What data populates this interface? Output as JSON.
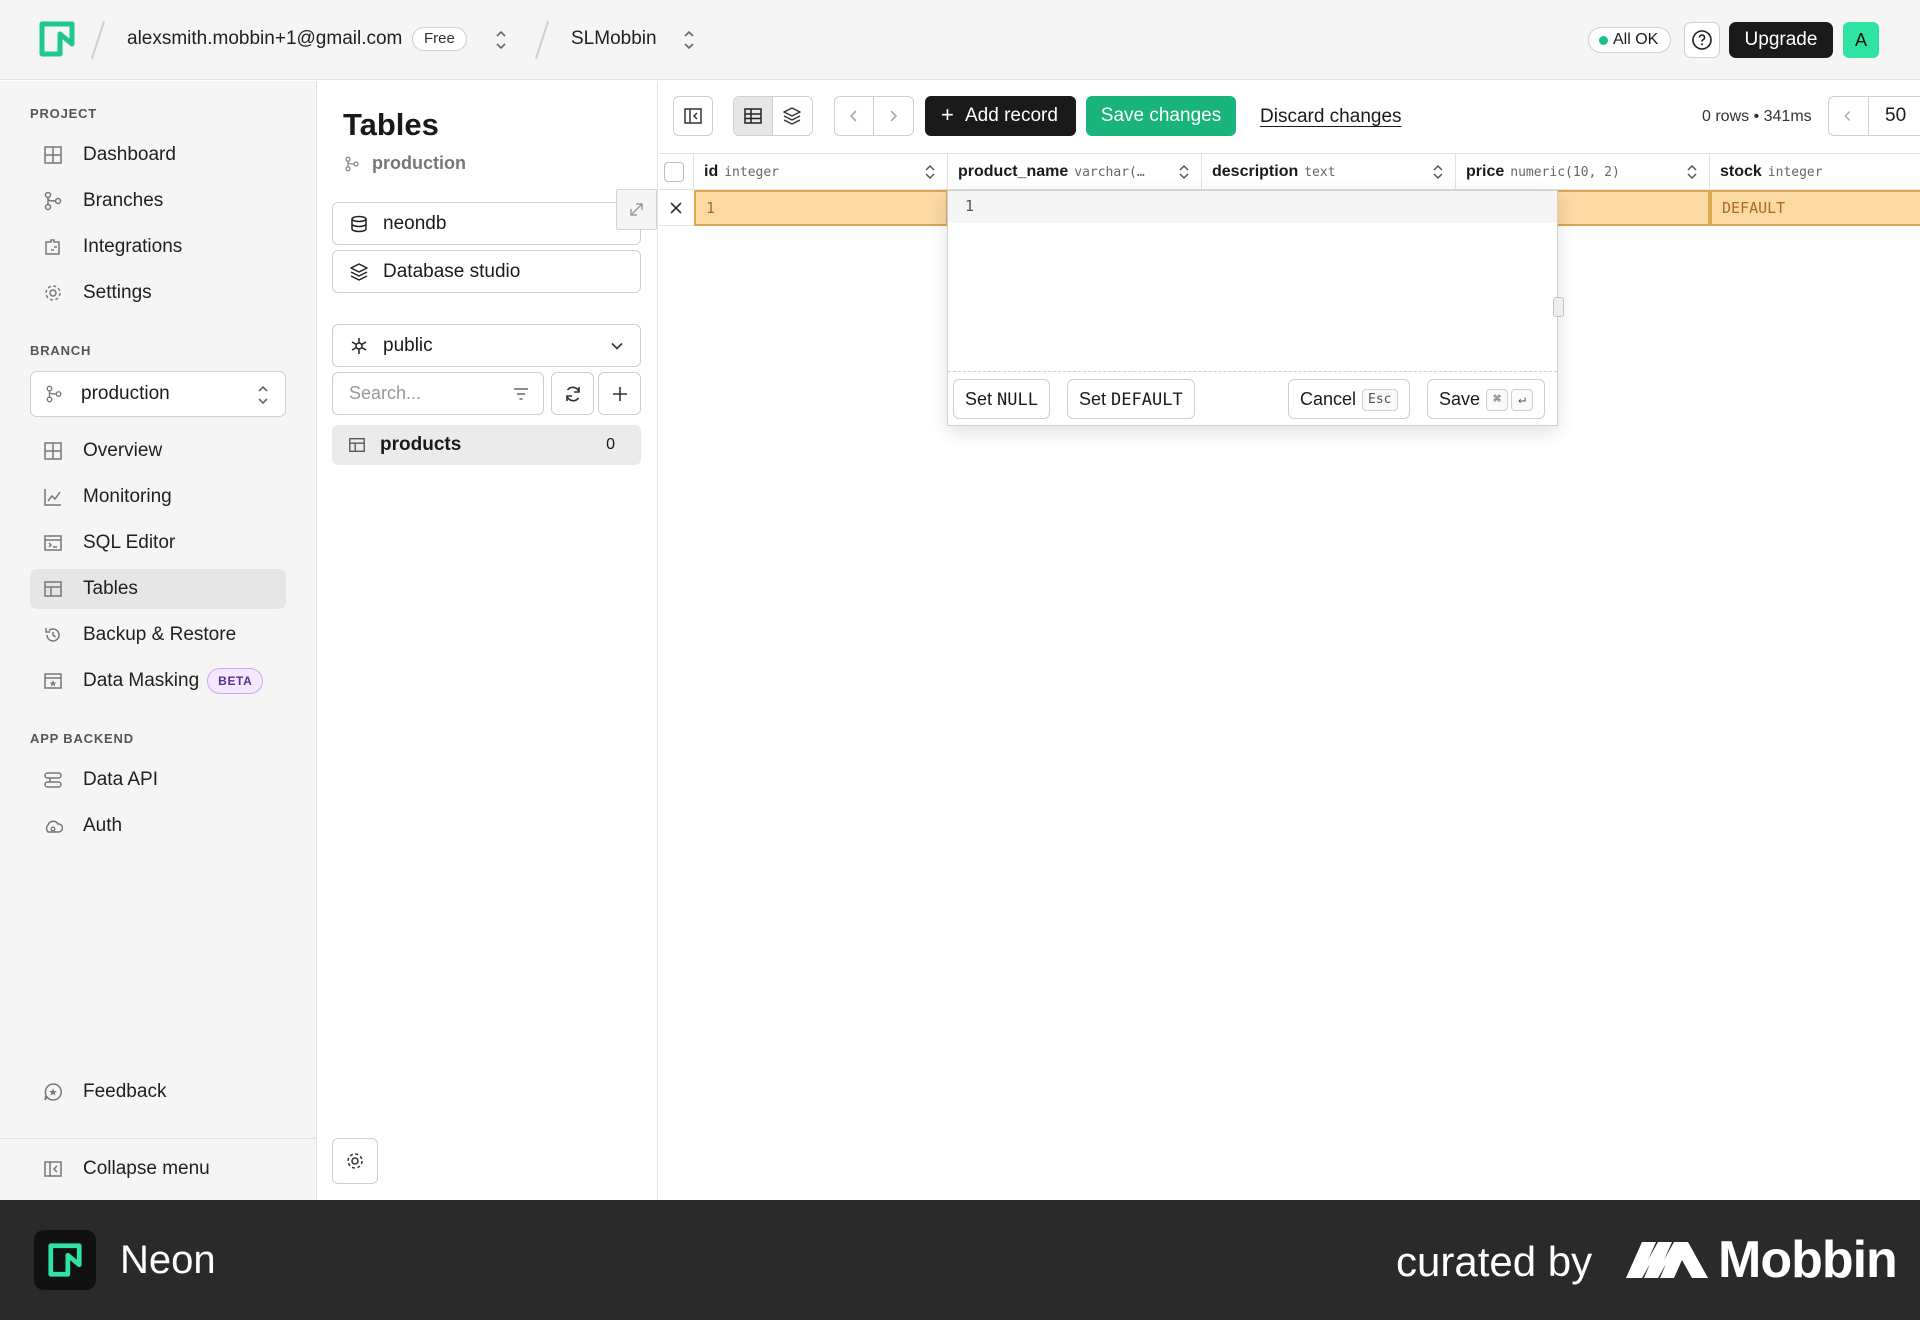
{
  "topbar": {
    "account": "alexsmith.mobbin+1@gmail.com",
    "plan": "Free",
    "project": "SLMobbin",
    "status": "All OK",
    "upgrade": "Upgrade",
    "avatar": "A"
  },
  "sidebar": {
    "project_label": "PROJECT",
    "project_items": [
      {
        "label": "Dashboard",
        "icon": "dashboard-icon"
      },
      {
        "label": "Branches",
        "icon": "branches-icon"
      },
      {
        "label": "Integrations",
        "icon": "integrations-icon"
      },
      {
        "label": "Settings",
        "icon": "gear-icon"
      }
    ],
    "branch_label": "BRANCH",
    "branch": "production",
    "branch_items": [
      {
        "label": "Overview",
        "icon": "overview-icon"
      },
      {
        "label": "Monitoring",
        "icon": "monitoring-icon"
      },
      {
        "label": "SQL Editor",
        "icon": "sql-editor-icon"
      },
      {
        "label": "Tables",
        "icon": "tables-icon",
        "active": true
      },
      {
        "label": "Backup & Restore",
        "icon": "restore-icon"
      },
      {
        "label": "Data Masking",
        "icon": "masking-icon",
        "badge": "BETA"
      }
    ],
    "backend_label": "APP BACKEND",
    "backend_items": [
      {
        "label": "Data API",
        "icon": "data-api-icon"
      },
      {
        "label": "Auth",
        "icon": "auth-icon"
      }
    ],
    "feedback": "Feedback",
    "collapse": "Collapse menu"
  },
  "tables_panel": {
    "title": "Tables",
    "branch": "production",
    "database": "neondb",
    "studio": "Database studio",
    "schema": "public",
    "search_placeholder": "Search...",
    "tables": [
      {
        "name": "products",
        "count": "0"
      }
    ]
  },
  "toolbar": {
    "add_record": "Add record",
    "save_changes": "Save changes",
    "discard_changes": "Discard changes",
    "row_info": "0 rows • 341ms",
    "page_size": "50"
  },
  "grid": {
    "columns": [
      {
        "name": "id",
        "type": "integer"
      },
      {
        "name": "product_name",
        "type": "varchar(…"
      },
      {
        "name": "description",
        "type": "text"
      },
      {
        "name": "price",
        "type": "numeric(10, 2)"
      },
      {
        "name": "stock",
        "type": "integer"
      }
    ],
    "row": {
      "id": "1",
      "stock": "DEFAULT"
    }
  },
  "editor": {
    "line_number": "1",
    "set_prefix": "Set",
    "null_label": "NULL",
    "default_label": "DEFAULT",
    "cancel": "Cancel",
    "cancel_key": "Esc",
    "save": "Save",
    "save_key_1": "⌘",
    "save_key_2": "↵"
  },
  "footer": {
    "app": "Neon",
    "curated_by": "curated by",
    "brand": "Mobbin"
  },
  "colors": {
    "accent_green": "#18b47b",
    "brand_green": "#2fe3a3",
    "edited_cell": "#fbd9a3"
  }
}
